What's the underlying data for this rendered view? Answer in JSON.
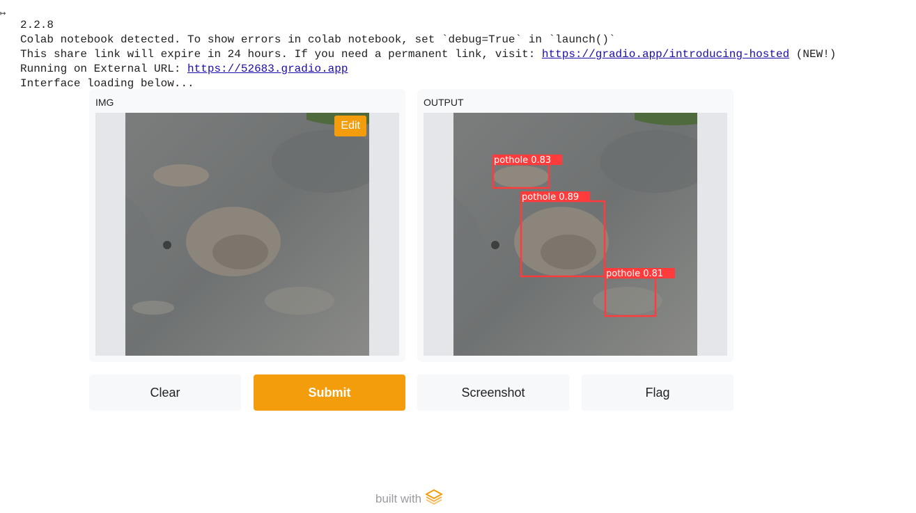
{
  "console": {
    "version": "2.2.8",
    "line1": "Colab notebook detected. To show errors in colab notebook, set `debug=True` in `launch()`",
    "line2_prefix": "This share link will expire in 24 hours. If you need a permanent link, visit: ",
    "line2_link": "https://gradio.app/introducing-hosted",
    "line2_suffix": " (NEW!)",
    "line3_prefix": "Running on External URL: ",
    "line3_link": "https://52683.gradio.app",
    "line4": "Interface loading below..."
  },
  "input_panel": {
    "label": "IMG",
    "edit_label": "Edit"
  },
  "output_panel": {
    "label": "OUTPUT",
    "detections": [
      {
        "label": "pothole 0.83"
      },
      {
        "label": "pothole 0.89"
      },
      {
        "label": "pothole 0.81"
      }
    ]
  },
  "buttons": {
    "clear": "Clear",
    "submit": "Submit",
    "screenshot": "Screenshot",
    "flag": "Flag"
  },
  "footer": {
    "text": "built with",
    "logo_icon": "gradio-logo-icon"
  },
  "colors": {
    "accent": "#f39c0c",
    "box": "#ff3b3b",
    "link": "#1a0dab"
  }
}
